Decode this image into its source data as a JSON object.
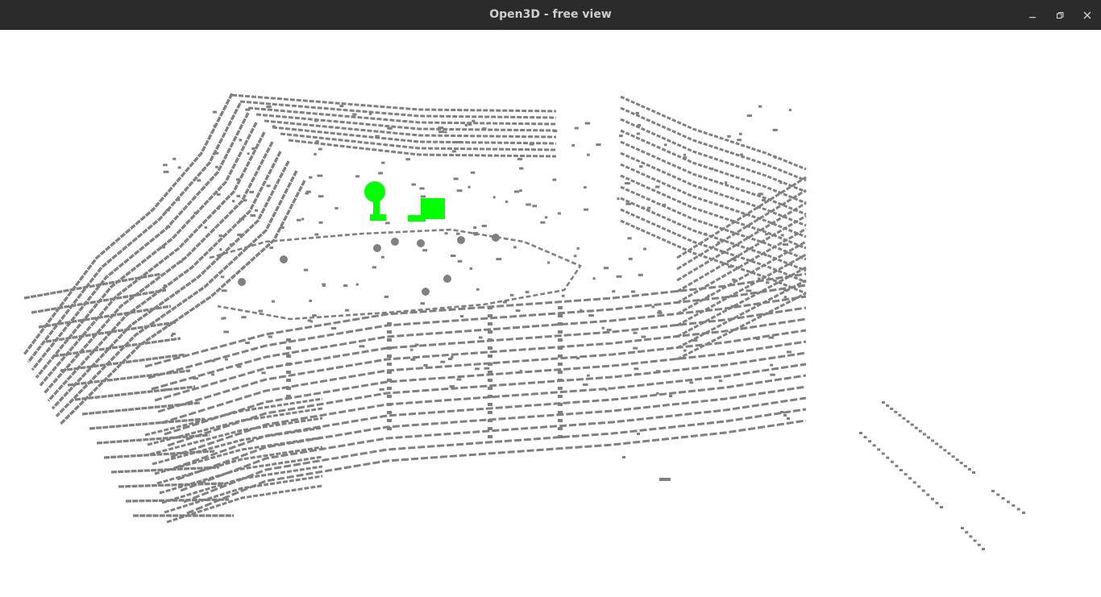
{
  "window": {
    "title": "Open3D - free view"
  },
  "titlebar_controls": {
    "minimize_icon": "minimize-icon",
    "restore_icon": "restore-icon",
    "close_icon": "close-icon"
  },
  "scene": {
    "point_color": "#808080",
    "highlight_color": "#00ff00",
    "background_color": "#ffffff"
  }
}
